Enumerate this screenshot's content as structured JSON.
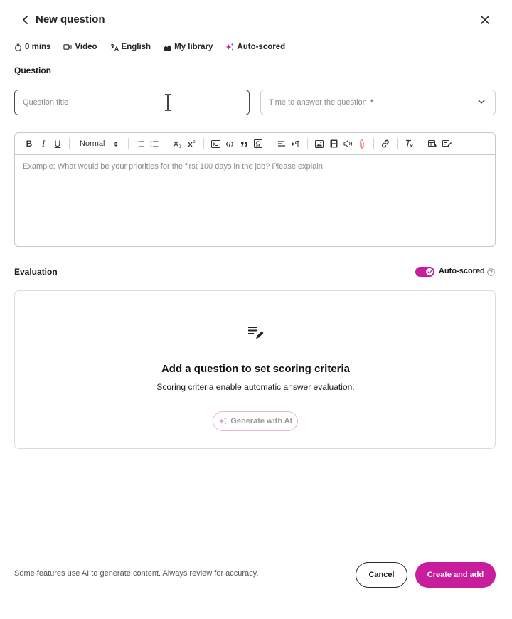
{
  "header": {
    "title": "New question"
  },
  "meta": {
    "duration": "0 mins",
    "format": "Video",
    "language": "English",
    "library": "My library",
    "scoring": "Auto-scored"
  },
  "question": {
    "section_label": "Question",
    "title_placeholder": "Question title",
    "time_placeholder": "Time to answer the question",
    "time_required_mark": "*"
  },
  "editor": {
    "format_value": "Normal",
    "placeholder": "Example: What would be your priorities for the first 100 days in the job? Please explain."
  },
  "evaluation": {
    "section_label": "Evaluation",
    "toggle_label": "Auto-scored",
    "toggle_on": true,
    "card_heading": "Add a question to set scoring criteria",
    "card_sub": "Scoring criteria enable automatic answer evaluation.",
    "generate_label": "Generate with AI"
  },
  "footer": {
    "note": "Some features use AI to generate content. Always review for accuracy.",
    "cancel_label": "Cancel",
    "create_label": "Create and add"
  },
  "colors": {
    "accent": "#c81d9d",
    "text": "#1a1a1a",
    "muted": "#8a8a8a",
    "border": "#c9c9c9"
  }
}
